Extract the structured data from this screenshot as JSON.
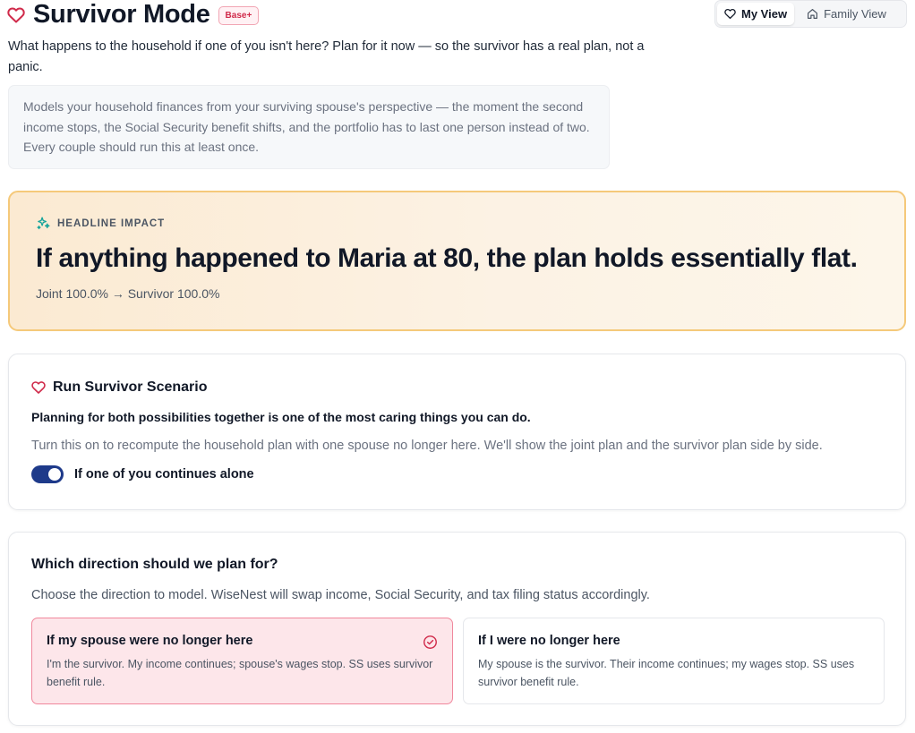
{
  "header": {
    "title": "Survivor Mode",
    "tier_badge": "Base+",
    "intro": "What happens to the household if one of you isn't here? Plan for it now — so the survivor has a real plan, not a panic.",
    "note": "Models your household finances from your surviving spouse's perspective — the moment the second income stops, the Social Security benefit shifts, and the portfolio has to last one person instead of two. Every couple should run this at least once."
  },
  "view_toggle": {
    "my_view": "My View",
    "family_view": "Family View",
    "active": "My View"
  },
  "impact": {
    "label": "HEADLINE IMPACT",
    "headline": "If anything happened to Maria at 80, the plan holds essentially flat.",
    "comparison": "Joint 100.0% → Survivor 100.0%"
  },
  "scenario": {
    "title": "Run Survivor Scenario",
    "lead": "Planning for both possibilities together is one of the most caring things you can do.",
    "description": "Turn this on to recompute the household plan with one spouse no longer here. We'll show the joint plan and the survivor plan side by side.",
    "toggle_label": "If one of you continues alone",
    "toggle_on": true
  },
  "direction": {
    "title": "Which direction should we plan for?",
    "description": "Choose the direction to model. WiseNest will swap income, Social Security, and tax filing status accordingly.",
    "options": [
      {
        "title": "If my spouse were no longer here",
        "description": "I'm the survivor. My income continues; spouse's wages stop. SS uses survivor benefit rule.",
        "selected": true
      },
      {
        "title": "If I were no longer here",
        "description": "My spouse is the survivor. Their income continues; my wages stop. SS uses survivor benefit rule.",
        "selected": false
      }
    ]
  },
  "colors": {
    "accent_red": "#d02b4b",
    "toggle_navy": "#1e3a8a",
    "impact_border": "#f5c97a",
    "selected_bg": "#fde6ea",
    "sparkle_teal": "#14a39a"
  },
  "icons": {
    "title": "heart-icon",
    "my_view": "heart-icon",
    "family_view": "home-icon",
    "impact": "sparkles-icon",
    "scenario": "heart-icon",
    "selected_option": "check-circle-icon"
  }
}
